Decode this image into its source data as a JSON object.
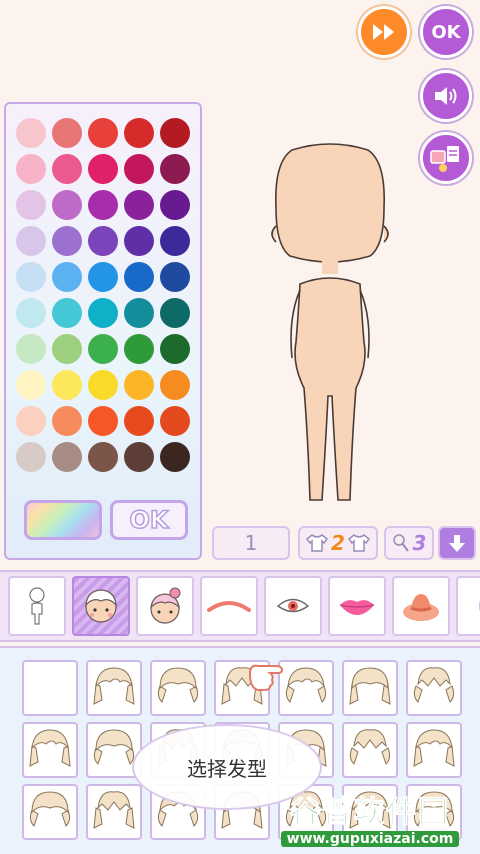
{
  "top_buttons": {
    "fast_forward_icon": "fast-forward-icon",
    "ok_label": "OK",
    "sound_icon": "speaker-icon",
    "scene_icon": "scene-icon"
  },
  "palette": {
    "colors": [
      "#f7c6cc",
      "#e77574",
      "#e8413b",
      "#d62b2a",
      "#b41a22",
      "#f7b4c8",
      "#ea5a8f",
      "#e02068",
      "#c2175f",
      "#8e1a52",
      "#e3c4e6",
      "#bd6bc7",
      "#a82dad",
      "#8a229c",
      "#681b91",
      "#d8c6ea",
      "#9b70cf",
      "#7c44bb",
      "#5e2fa6",
      "#3c2a9a",
      "#c6dff4",
      "#5cb2f0",
      "#2495e6",
      "#1969c8",
      "#1e4aa0",
      "#bfe9ee",
      "#45c8d6",
      "#0fb0c8",
      "#148e9a",
      "#0d6a66",
      "#c6e8c4",
      "#9cd07e",
      "#3db04e",
      "#2e9a3a",
      "#1c6a2c",
      "#fff4c2",
      "#fde75a",
      "#f9da2a",
      "#fbb527",
      "#f68b1f",
      "#fcd0c0",
      "#f78b5e",
      "#f55826",
      "#e74b1d",
      "#e54a1e",
      "#d8cbc6",
      "#a68c84",
      "#7a5548",
      "#5c3e36",
      "#3c2620"
    ],
    "ok_label": "OK"
  },
  "selectors": {
    "option1_value": "1",
    "option2_value": "2",
    "option3_value": "3",
    "down_icon": "arrow-down-icon"
  },
  "categories": [
    {
      "name": "body",
      "icon": "body-icon"
    },
    {
      "name": "hair-front",
      "icon": "face-hair-icon"
    },
    {
      "name": "hair-back",
      "icon": "hair-bun-icon"
    },
    {
      "name": "eyebrows",
      "icon": "eyebrow-icon"
    },
    {
      "name": "eyes",
      "icon": "eye-icon"
    },
    {
      "name": "mouth",
      "icon": "lips-icon"
    },
    {
      "name": "hat",
      "icon": "hat-icon"
    }
  ],
  "tooltip": {
    "text": "选择发型"
  },
  "watermark": {
    "title": "谷普软件园",
    "url": "www.gupuxiazai.com"
  }
}
